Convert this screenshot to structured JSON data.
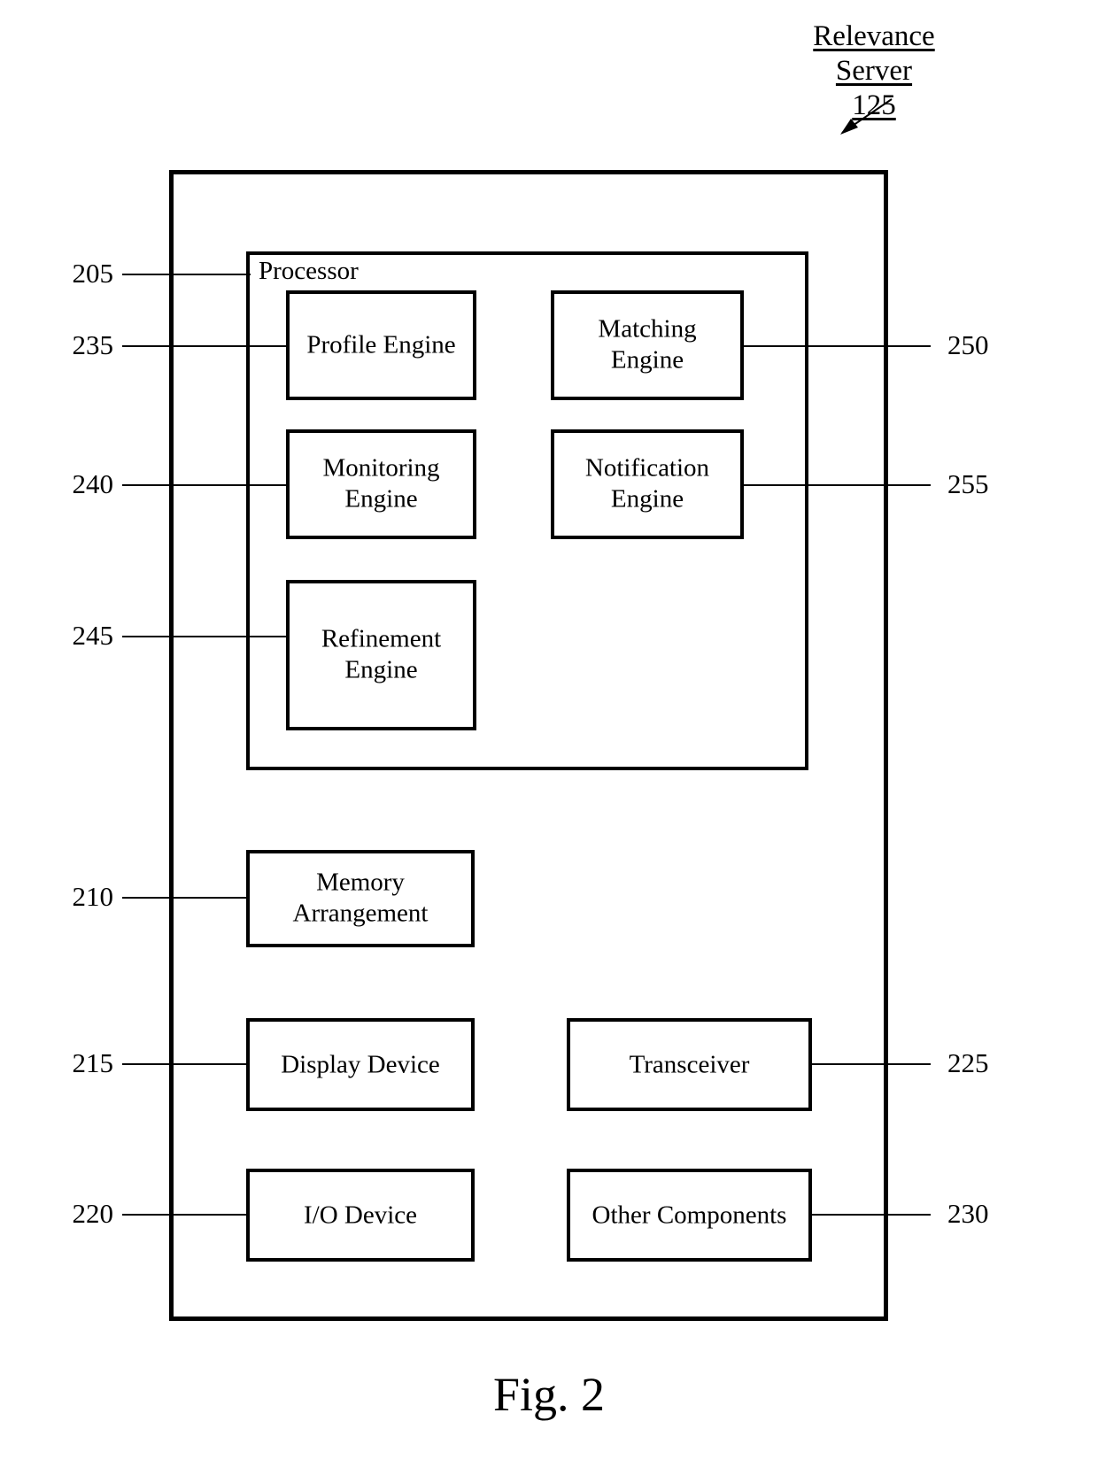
{
  "figure": {
    "caption": "Fig. 2",
    "title": {
      "name": "Relevance Server",
      "number": "125"
    }
  },
  "outer_box": {
    "name": "Relevance Server enclosure"
  },
  "processor": {
    "label": "Processor",
    "ref": "205",
    "engines": [
      {
        "label": "Profile Engine",
        "ref": "235",
        "side": "left"
      },
      {
        "label": "Matching Engine",
        "ref": "250",
        "side": "right"
      },
      {
        "label": "Monitoring Engine",
        "ref": "240",
        "side": "left"
      },
      {
        "label": "Notification Engine",
        "ref": "255",
        "side": "right"
      },
      {
        "label": "Refinement Engine",
        "ref": "245",
        "side": "left"
      }
    ]
  },
  "components": [
    {
      "label": "Memory Arrangement",
      "ref": "210",
      "side": "left"
    },
    {
      "label": "Display Device",
      "ref": "215",
      "side": "left"
    },
    {
      "label": "Transceiver",
      "ref": "225",
      "side": "right"
    },
    {
      "label": "I/O Device",
      "ref": "220",
      "side": "left"
    },
    {
      "label": "Other Components",
      "ref": "230",
      "side": "right"
    }
  ],
  "colors": {
    "ink": "#000000",
    "paper": "#ffffff"
  }
}
